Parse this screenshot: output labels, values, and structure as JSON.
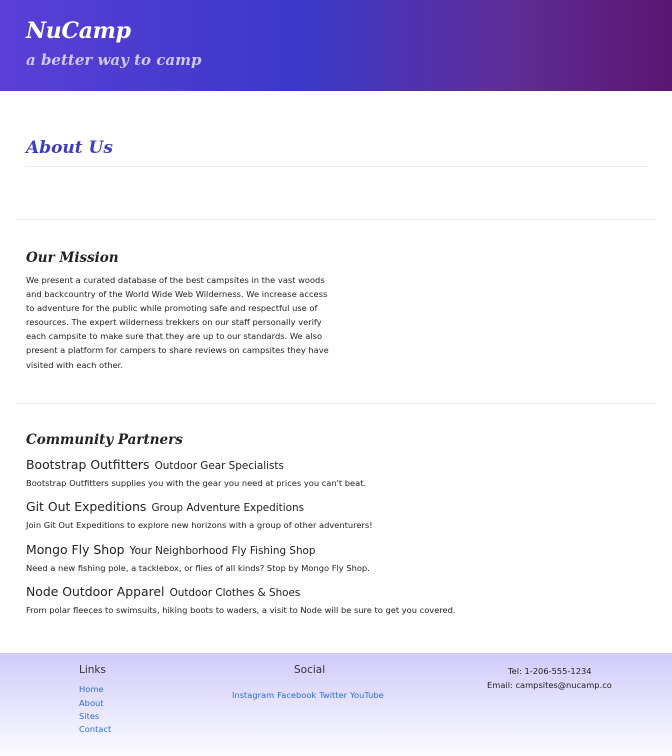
{
  "header": {
    "brand": "NuCamp",
    "tagline": "a better way to camp"
  },
  "main": {
    "page_title": "About Us",
    "mission": {
      "heading": "Our Mission",
      "text": "We present a curated database of the best campsites in the vast woods and backcountry of the World Wide Web Wilderness. We increase access to adventure for the public while promoting safe and respectful use of resources. The expert wilderness trekkers on our staff personally verify each campsite to make sure that they are up to our standards. We also present a platform for campers to share reviews on campsites they have visited with each other."
    },
    "partners": {
      "heading": "Community Partners",
      "items": [
        {
          "name": "Bootstrap Outfitters",
          "subtitle": "Outdoor Gear Specialists",
          "description": "Bootstrap Outfitters supplies you with the gear you need at prices you can't beat."
        },
        {
          "name": "Git Out Expeditions",
          "subtitle": "Group Adventure Expeditions",
          "description": "Join Git Out Expeditions to explore new horizons with a group of other adventurers!"
        },
        {
          "name": "Mongo Fly Shop",
          "subtitle": "Your Neighborhood Fly Fishing Shop",
          "description": "Need a new fishing pole, a tacklebox, or flies of all kinds? Stop by Mongo Fly Shop."
        },
        {
          "name": "Node Outdoor Apparel",
          "subtitle": "Outdoor Clothes & Shoes",
          "description": "From polar fleeces to swimsuits, hiking boots to waders, a visit to Node will be sure to get you covered."
        }
      ]
    }
  },
  "footer": {
    "links_heading": "Links",
    "links": [
      "Home",
      "About",
      "Sites",
      "Contact"
    ],
    "social_heading": "Social",
    "social": [
      "Instagram",
      "Facebook",
      "Twitter",
      "YouTube"
    ],
    "tel": "Tel: 1-206-555-1234",
    "email": "Email: campsites@nucamp.co"
  }
}
